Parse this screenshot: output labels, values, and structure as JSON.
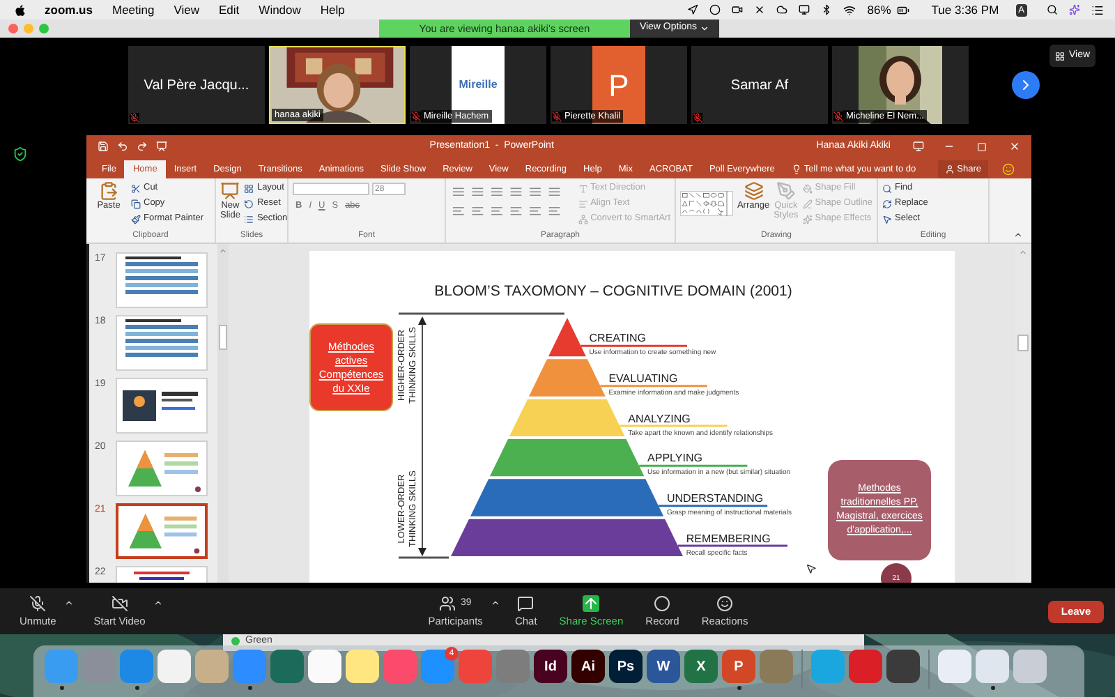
{
  "menu_bar": {
    "app_name": "zoom.us",
    "menus": [
      "Meeting",
      "View",
      "Edit",
      "Window",
      "Help"
    ],
    "battery_percent": "86%",
    "clock": "Tue 3:36 PM",
    "input_source": "A"
  },
  "zoom_window": {
    "banner": "You are viewing hanaa akiki's screen",
    "view_options": "View Options",
    "view_button": "View"
  },
  "participants": [
    {
      "kind": "name",
      "display": "Val Père Jacqu...",
      "muted": true,
      "active": false
    },
    {
      "kind": "video",
      "label": "hanaa akiki",
      "muted": false,
      "active": true
    },
    {
      "kind": "avatar_text",
      "display": "Mireille",
      "label": "Mireille Hachem",
      "muted": true,
      "active": false
    },
    {
      "kind": "avatar_letter",
      "display": "P",
      "label": "Pierette Khalil",
      "muted": true,
      "active": false
    },
    {
      "kind": "name",
      "display": "Samar Af",
      "muted": true,
      "active": false
    },
    {
      "label": "Micheline El Nem...",
      "muted": true,
      "active": false
    }
  ],
  "powerpoint": {
    "title": "Presentation1  -  PowerPoint",
    "user": "Hanaa Akiki Akiki",
    "tabs": [
      {
        "label": "File",
        "selected": false
      },
      {
        "label": "Home",
        "selected": true
      },
      {
        "label": "Insert",
        "selected": false
      },
      {
        "label": "Design",
        "selected": false
      },
      {
        "label": "Transitions",
        "selected": false
      },
      {
        "label": "Animations",
        "selected": false
      },
      {
        "label": "Slide Show",
        "selected": false
      },
      {
        "label": "Review",
        "selected": false
      },
      {
        "label": "View",
        "selected": false
      },
      {
        "label": "Recording",
        "selected": false
      },
      {
        "label": "Help",
        "selected": false
      },
      {
        "label": "Mix",
        "selected": false
      },
      {
        "label": "ACROBAT",
        "selected": false
      },
      {
        "label": "Poll Everywhere",
        "selected": false
      }
    ],
    "tell_me": "Tell me what you want to do",
    "share": "Share",
    "ribbon": [
      {
        "kind": "clipboard",
        "label": "Clipboard",
        "big": [
          {
            "label": "Paste",
            "disabled": false
          }
        ],
        "items": [
          {
            "label": "Cut",
            "disabled": false
          },
          {
            "label": "Copy",
            "disabled": false
          },
          {
            "label": "Format Painter",
            "disabled": false
          }
        ]
      },
      {
        "kind": "slides",
        "label": "Slides",
        "big": [
          {
            "label": "New Slide",
            "disabled": false
          }
        ],
        "items": [
          {
            "label": "Layout",
            "disabled": false
          },
          {
            "label": "Reset",
            "disabled": false
          },
          {
            "label": "Section",
            "disabled": false
          }
        ]
      },
      {
        "kind": "font",
        "label": "Font",
        "size": "28",
        "buttons": [
          "B",
          "I",
          "U",
          "S",
          "abc"
        ]
      },
      {
        "kind": "paragraph",
        "label": "Paragraph",
        "items": [
          {
            "label": "Text Direction",
            "disabled": true
          },
          {
            "label": "Align Text",
            "disabled": true
          },
          {
            "label": "Convert to SmartArt",
            "disabled": true
          }
        ]
      },
      {
        "kind": "drawing",
        "label": "Drawing",
        "big": [
          {
            "label": "Arrange",
            "disabled": false
          },
          {
            "label": "Quick Styles",
            "disabled": true
          }
        ],
        "items": [
          {
            "label": "Shape Fill",
            "disabled": true
          },
          {
            "label": "Shape Outline",
            "disabled": true
          },
          {
            "label": "Shape Effects",
            "disabled": true
          }
        ]
      },
      {
        "kind": "editing",
        "label": "Editing",
        "items": [
          {
            "label": "Find",
            "disabled": false
          },
          {
            "label": "Replace",
            "disabled": false
          },
          {
            "label": "Select",
            "disabled": false
          }
        ]
      }
    ],
    "thumbnails": [
      {
        "number": "17",
        "kind": "table",
        "selected": false
      },
      {
        "number": "18",
        "kind": "table",
        "selected": false
      },
      {
        "number": "19",
        "selected": false
      },
      {
        "number": "20",
        "kind": "pyramid",
        "selected": false
      },
      {
        "number": "21",
        "kind": "pyramid",
        "selected": true
      },
      {
        "number": "22",
        "kind": "text",
        "selected": false
      }
    ],
    "slide": {
      "title": "BLOOM’S TAXOMONY – COGNITIVE DOMAIN (2001)",
      "left_note": "Méthodes actives Compétences du XXIe",
      "higher_label": "HIGHER-ORDER THINKING SKILLS",
      "lower_label": "LOWER-ORDER THINKING SKILLS",
      "levels": [
        {
          "title": "CREATING",
          "description": "Use information to create something new",
          "color": "#e63b2e"
        },
        {
          "title": "EVALUATING",
          "description": "Examine information and make judgments",
          "color": "#f0913e"
        },
        {
          "title": "ANALYZING",
          "description": "Take apart the known and identify relationships",
          "color": "#f7d154"
        },
        {
          "title": "APPLYING",
          "description": "Use information in a new (but similar) situation",
          "color": "#4caf50"
        },
        {
          "title": "UNDERSTANDING",
          "description": "Grasp meaning of instructional materials",
          "color": "#2b6cb8"
        },
        {
          "title": "REMEMBERING",
          "description": "Recall specific facts",
          "color": "#6a3d9a"
        }
      ],
      "right_note": "Methodes traditionnelles PP, Magistral, exercices d'application,...",
      "page_number": "21"
    }
  },
  "toolbar": {
    "left": [
      {
        "kind": "mic",
        "label": "Unmute",
        "menu": true
      },
      {
        "kind": "video",
        "label": "Start Video",
        "menu": true
      }
    ],
    "center": [
      {
        "kind": "participants",
        "label": "Participants",
        "count": "39",
        "menu": true
      },
      {
        "kind": "chat",
        "label": "Chat",
        "menu": false
      },
      {
        "kind": "share",
        "label": "Share Screen",
        "menu": false
      },
      {
        "kind": "record",
        "label": "Record",
        "menu": false
      },
      {
        "kind": "reactions",
        "label": "Reactions",
        "menu": false
      }
    ],
    "leave": "Leave"
  },
  "desktop": {
    "window_label": "Green",
    "dock": [
      {
        "kind": "app",
        "color": "#3a9cf0",
        "running": true
      },
      {
        "kind": "app",
        "color": "#8a8f99",
        "running": false
      },
      {
        "kind": "app",
        "color": "#1e88e5",
        "running": true
      },
      {
        "kind": "app",
        "color": "#f2f2f2",
        "running": false
      },
      {
        "kind": "app",
        "color": "#c7b089",
        "running": false
      },
      {
        "kind": "app",
        "color": "#2d8cff",
        "running": true
      },
      {
        "kind": "app",
        "color": "#1c6b5a",
        "running": false
      },
      {
        "kind": "app",
        "color": "#fafafa",
        "running": false
      },
      {
        "kind": "app",
        "color": "#ffe680",
        "running": false
      },
      {
        "kind": "app",
        "color": "#fa4b6b",
        "running": false
      },
      {
        "kind": "app",
        "color": "#1e90ff",
        "badge": "4",
        "running": false
      },
      {
        "kind": "app",
        "color": "#ef443b",
        "running": false
      },
      {
        "kind": "app",
        "color": "#7d7d7d",
        "running": false
      },
      {
        "kind": "app",
        "color": "#49021f",
        "label": "Id",
        "running": false
      },
      {
        "kind": "app",
        "color": "#330000",
        "label": "Ai",
        "running": false
      },
      {
        "kind": "app",
        "color": "#001e36",
        "label": "Ps",
        "running": false
      },
      {
        "kind": "app",
        "color": "#2b579a",
        "label": "W",
        "running": false
      },
      {
        "kind": "app",
        "color": "#217346",
        "label": "X",
        "running": false
      },
      {
        "kind": "app",
        "color": "#d24726",
        "label": "P",
        "running": true
      },
      {
        "kind": "app",
        "color": "#8a7a5a",
        "running": false
      },
      {
        "kind": "separator"
      },
      {
        "kind": "app",
        "color": "#1aa7e0",
        "running": false
      },
      {
        "kind": "app",
        "color": "#da1f26",
        "running": false
      },
      {
        "kind": "app",
        "color": "#3b3b3b",
        "running": false
      },
      {
        "kind": "separator"
      },
      {
        "kind": "app",
        "color": "#e9eef5",
        "running": false
      },
      {
        "kind": "app",
        "color": "#dfe6ee",
        "running": true
      },
      {
        "kind": "app",
        "color": "#c9ced6",
        "running": false
      }
    ]
  }
}
